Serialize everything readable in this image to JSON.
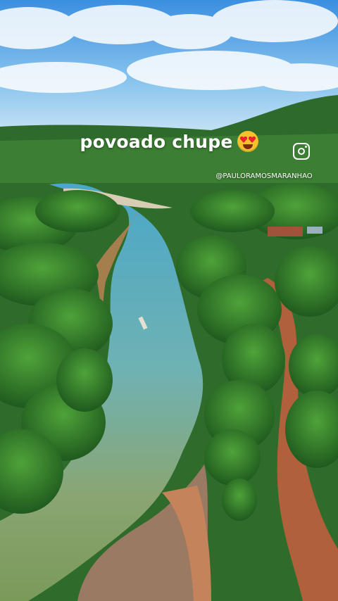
{
  "overlay": {
    "caption": "povoado chupe",
    "caption_emoji": "heart-eyes-emoji",
    "social_icon": "instagram-icon",
    "handle": "@PAULORAMOSMARANHAO"
  },
  "colors": {
    "sky": "#5fa8e0",
    "forest": "#2f6b2a",
    "river": "#7fa28a",
    "dirt_road": "#b0603a"
  }
}
